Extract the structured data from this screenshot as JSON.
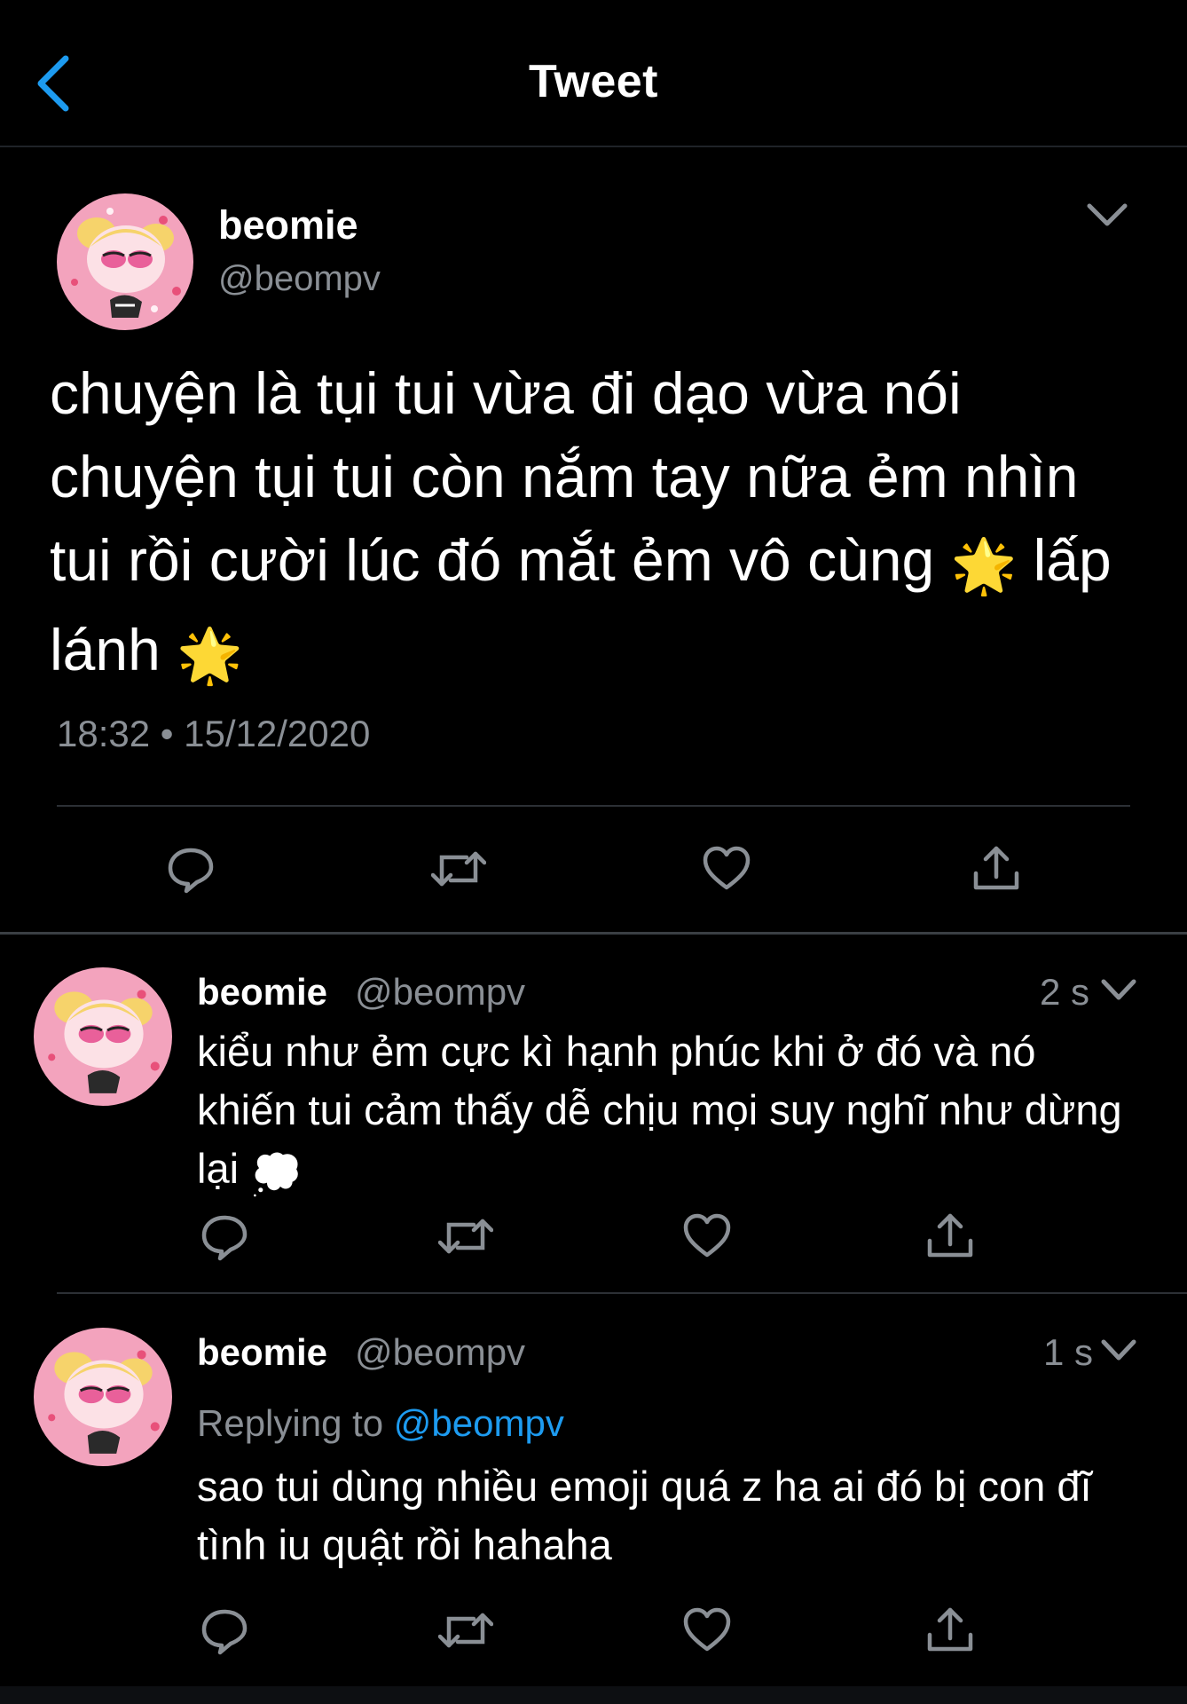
{
  "header": {
    "title": "Tweet"
  },
  "main_tweet": {
    "display_name": "beomie",
    "handle": "@beompv",
    "text_before": "chuyện là tụi tui vừa đi dạo vừa nói chuyện tụi tui còn nắm tay nữa ẻm nhìn tui rồi cười lúc đó mắt ẻm vô cùng",
    "emoji_1": "🌟",
    "text_middle": "lấp lánh",
    "emoji_2": "🌟",
    "timestamp": "18:32 • 15/12/2020"
  },
  "replies": [
    {
      "display_name": "beomie",
      "handle": "@beompv",
      "time": "2 s",
      "text": "kiểu như ẻm cực kì hạnh phúc khi ở đó và nó khiến tui cảm thấy dễ chịu mọi suy nghĩ như dừng lại",
      "emoji": "💭"
    },
    {
      "display_name": "beomie",
      "handle": "@beompv",
      "time": "1 s",
      "replying_label": "Replying to",
      "replying_to": "@beompv",
      "text": "sao tui dùng nhiều emoji quá z ha ai đó bị con đĩ tình iu quật rồi hahaha"
    }
  ],
  "icons": [
    "back-arrow-icon",
    "chevron-down-icon",
    "reply-icon",
    "retweet-icon",
    "like-icon",
    "share-icon",
    "sparkle-icon",
    "thought-balloon-icon"
  ],
  "colors": {
    "background": "#000000",
    "text": "#ffffff",
    "secondary": "#8a8f95",
    "accent": "#1d9bf0",
    "divider": "#2c3035"
  }
}
